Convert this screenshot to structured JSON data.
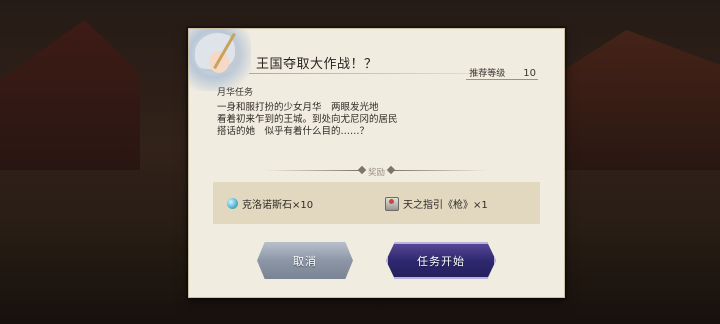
{
  "quest": {
    "title": "王国夺取大作战！？",
    "recommend_label": "推荐等级",
    "recommend_value": "10",
    "subtitle": "月华任务",
    "description_lines": [
      "一身和服打扮的少女月华　两眼发光地",
      "看着初来乍到的王城。到处向尤尼冈的居民",
      "搭话的她　似乎有着什么目的……？"
    ]
  },
  "rewards": {
    "title": "奖励",
    "items": [
      {
        "icon": "chronos-stone-icon",
        "label": "克洛诺斯石×10"
      },
      {
        "icon": "ring-icon",
        "label": "天之指引《枪》×1"
      }
    ]
  },
  "buttons": {
    "cancel": "取消",
    "start": "任务开始"
  }
}
